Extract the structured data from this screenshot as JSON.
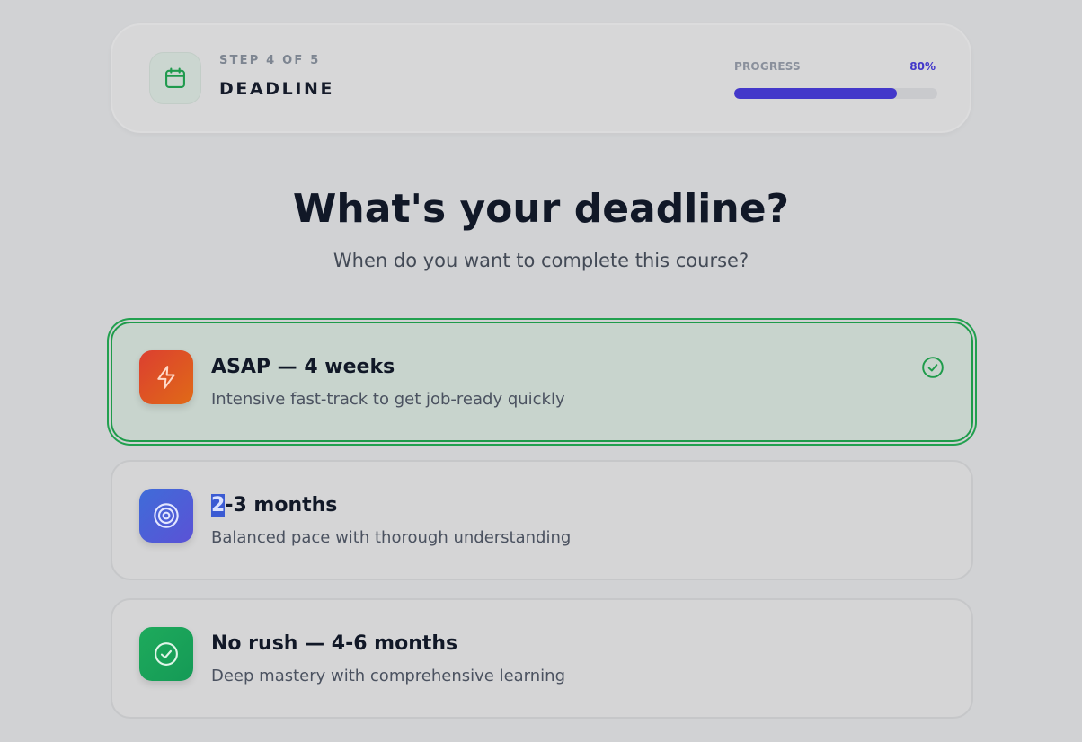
{
  "header": {
    "step_label": "STEP 4 OF 5",
    "step_title": "DEADLINE",
    "step_icon": "calendar-icon",
    "progress_label": "PROGRESS",
    "progress_percent_text": "80%",
    "progress_value": 0.8
  },
  "question": {
    "title": "What's your deadline?",
    "subtitle": "When do you want to complete this course?"
  },
  "options": [
    {
      "title": "ASAP — 4 weeks",
      "description": "Intensive fast-track to get job-ready quickly",
      "icon": "lightning-bolt-icon",
      "selected": true,
      "icon_gradient": [
        "#dc3f30",
        "#e06a17"
      ]
    },
    {
      "title_highlighted_prefix": "2",
      "title_rest": "-3 months",
      "description": "Balanced pace with thorough understanding",
      "icon": "target-icon",
      "selected": false,
      "icon_gradient": [
        "#3f6cd8",
        "#5b52d6"
      ]
    },
    {
      "title": "No rush — 4-6 months",
      "description": "Deep mastery with comprehensive learning",
      "icon": "check-circle-icon",
      "selected": false,
      "icon_gradient": [
        "#1eaa5c",
        "#159a56"
      ]
    }
  ],
  "colors": {
    "accent": "#4338ca",
    "selected_border": "#1e9b4a",
    "background": "#d1d2d4"
  }
}
